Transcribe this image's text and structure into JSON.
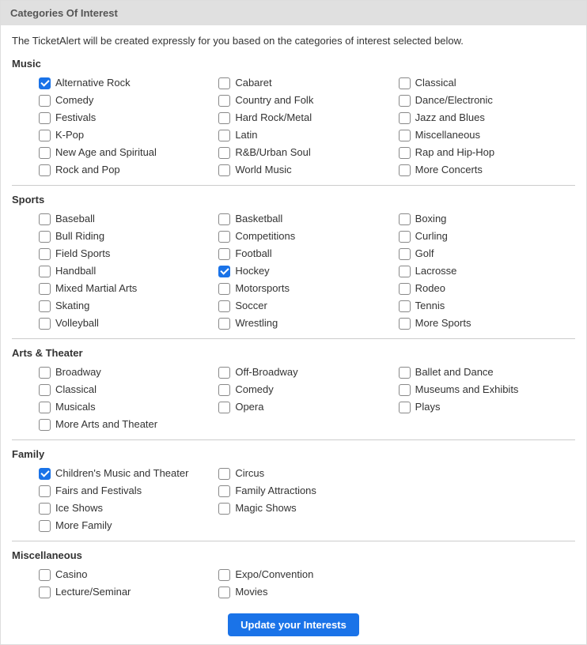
{
  "header": {
    "title": "Categories Of Interest"
  },
  "description": "The TicketAlert will be created expressly for you based on the categories of interest selected below.",
  "sections": [
    {
      "title": "Music",
      "items": [
        {
          "label": "Alternative Rock",
          "checked": true
        },
        {
          "label": "Cabaret",
          "checked": false
        },
        {
          "label": "Classical",
          "checked": false
        },
        {
          "label": "Comedy",
          "checked": false
        },
        {
          "label": "Country and Folk",
          "checked": false
        },
        {
          "label": "Dance/Electronic",
          "checked": false
        },
        {
          "label": "Festivals",
          "checked": false
        },
        {
          "label": "Hard Rock/Metal",
          "checked": false
        },
        {
          "label": "Jazz and Blues",
          "checked": false
        },
        {
          "label": "K-Pop",
          "checked": false
        },
        {
          "label": "Latin",
          "checked": false
        },
        {
          "label": "Miscellaneous",
          "checked": false
        },
        {
          "label": "New Age and Spiritual",
          "checked": false
        },
        {
          "label": "R&B/Urban Soul",
          "checked": false
        },
        {
          "label": "Rap and Hip-Hop",
          "checked": false
        },
        {
          "label": "Rock and Pop",
          "checked": false
        },
        {
          "label": "World Music",
          "checked": false
        },
        {
          "label": "More Concerts",
          "checked": false
        }
      ]
    },
    {
      "title": "Sports",
      "items": [
        {
          "label": "Baseball",
          "checked": false
        },
        {
          "label": "Basketball",
          "checked": false
        },
        {
          "label": "Boxing",
          "checked": false
        },
        {
          "label": "Bull Riding",
          "checked": false
        },
        {
          "label": "Competitions",
          "checked": false
        },
        {
          "label": "Curling",
          "checked": false
        },
        {
          "label": "Field Sports",
          "checked": false
        },
        {
          "label": "Football",
          "checked": false
        },
        {
          "label": "Golf",
          "checked": false
        },
        {
          "label": "Handball",
          "checked": false
        },
        {
          "label": "Hockey",
          "checked": true
        },
        {
          "label": "Lacrosse",
          "checked": false
        },
        {
          "label": "Mixed Martial Arts",
          "checked": false
        },
        {
          "label": "Motorsports",
          "checked": false
        },
        {
          "label": "Rodeo",
          "checked": false
        },
        {
          "label": "Skating",
          "checked": false
        },
        {
          "label": "Soccer",
          "checked": false
        },
        {
          "label": "Tennis",
          "checked": false
        },
        {
          "label": "Volleyball",
          "checked": false
        },
        {
          "label": "Wrestling",
          "checked": false
        },
        {
          "label": "More Sports",
          "checked": false
        }
      ]
    },
    {
      "title": "Arts & Theater",
      "items": [
        {
          "label": "Broadway",
          "checked": false
        },
        {
          "label": "Off-Broadway",
          "checked": false
        },
        {
          "label": "Ballet and Dance",
          "checked": false
        },
        {
          "label": "Classical",
          "checked": false
        },
        {
          "label": "Comedy",
          "checked": false
        },
        {
          "label": "Museums and Exhibits",
          "checked": false
        },
        {
          "label": "Musicals",
          "checked": false
        },
        {
          "label": "Opera",
          "checked": false
        },
        {
          "label": "Plays",
          "checked": false
        },
        {
          "label": "More Arts and Theater",
          "checked": false
        }
      ]
    },
    {
      "title": "Family",
      "items": [
        {
          "label": "Children's Music and Theater",
          "checked": true
        },
        {
          "label": "Circus",
          "checked": false
        },
        {
          "label": "",
          "checked": null
        },
        {
          "label": "Fairs and Festivals",
          "checked": false
        },
        {
          "label": "Family Attractions",
          "checked": false
        },
        {
          "label": "",
          "checked": null
        },
        {
          "label": "Ice Shows",
          "checked": false
        },
        {
          "label": "Magic Shows",
          "checked": false
        },
        {
          "label": "",
          "checked": null
        },
        {
          "label": "More Family",
          "checked": false
        }
      ]
    },
    {
      "title": "Miscellaneous",
      "items": [
        {
          "label": "Casino",
          "checked": false
        },
        {
          "label": "Expo/Convention",
          "checked": false
        },
        {
          "label": "",
          "checked": null
        },
        {
          "label": "Lecture/Seminar",
          "checked": false
        },
        {
          "label": "Movies",
          "checked": false
        }
      ],
      "last": true
    }
  ],
  "submit": {
    "label": "Update your Interests"
  }
}
